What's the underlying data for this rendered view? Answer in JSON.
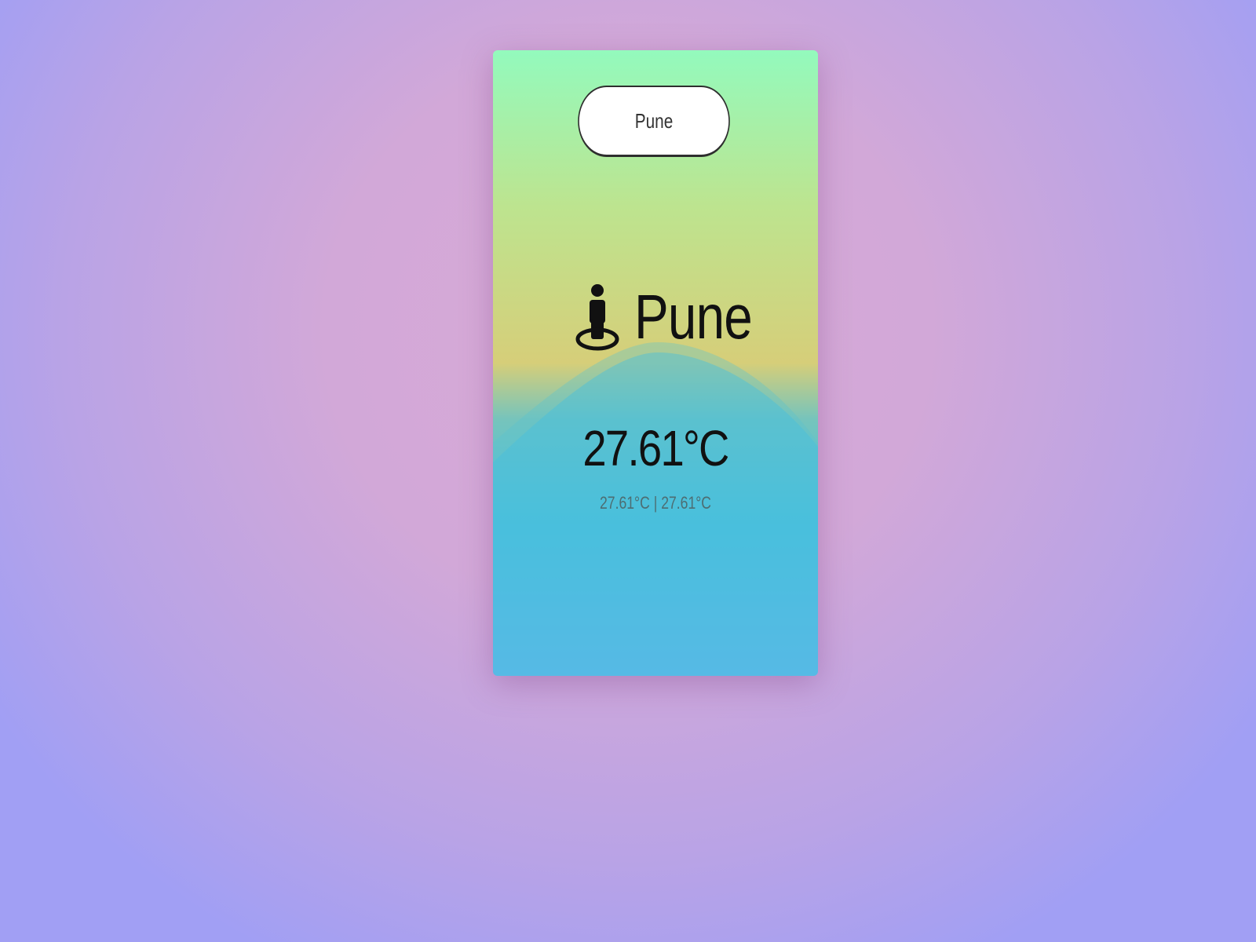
{
  "search": {
    "value": "Pune",
    "placeholder": ""
  },
  "weather": {
    "city": "Pune",
    "temperature": "27.61°C",
    "temp_min": "27.61°C",
    "temp_max": "27.61°C",
    "separator": "|"
  },
  "icons": {
    "location": "person-location-icon"
  },
  "colors": {
    "page_bg_center": "#d8aad6",
    "page_bg_edge": "#a19ff4",
    "card_top": "#93fabd",
    "card_middle": "#d6ce79",
    "card_lower": "#44bfe2",
    "card_bottom": "#6aaffa"
  }
}
